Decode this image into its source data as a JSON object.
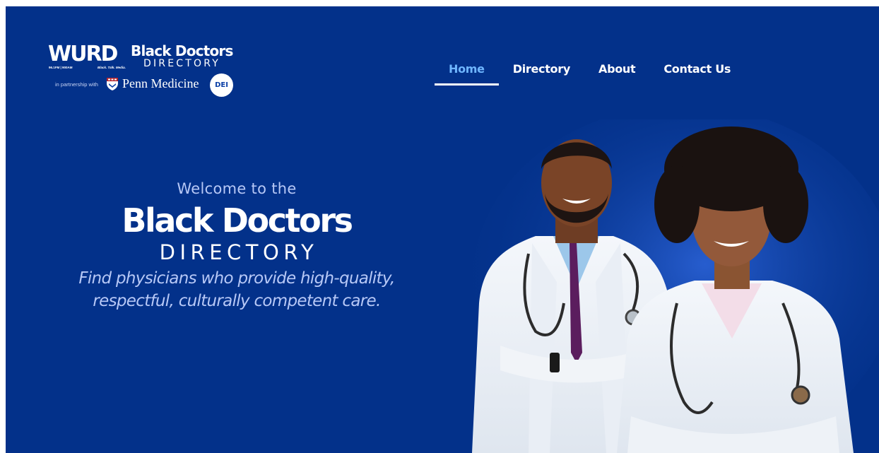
{
  "header": {
    "logo": {
      "brand_mark": "WURD",
      "brand_tag_left": "96.1FM | 900AM",
      "brand_tag_right": "Black. Talk. Media.",
      "title": "Black Doctors",
      "subtitle": "DIRECTORY",
      "partner_prefix": "in partnership with",
      "partner_name": "Penn Medicine",
      "badge_text": "DEI"
    },
    "nav": [
      {
        "label": "Home",
        "active": true
      },
      {
        "label": "Directory",
        "active": false
      },
      {
        "label": "About",
        "active": false
      },
      {
        "label": "Contact Us",
        "active": false
      }
    ]
  },
  "hero": {
    "welcome": "Welcome to the",
    "title": "Black Doctors",
    "subtitle": "DIRECTORY",
    "tagline_line1": "Find physicians who provide high-quality,",
    "tagline_line2": "respectful, culturally competent care."
  },
  "colors": {
    "background": "#03318a",
    "nav_active": "#6fb6ff",
    "text_light": "#b7c8f6",
    "text_white": "#ffffff"
  }
}
